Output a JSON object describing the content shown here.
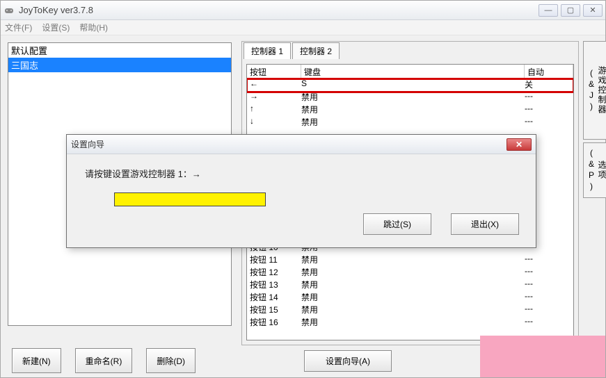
{
  "window": {
    "title": "JoyToKey ver3.7.8"
  },
  "menu": {
    "file": "文件(F)",
    "settings": "设置(S)",
    "help": "帮助(H)"
  },
  "configs": {
    "item0": "默认配置",
    "item1": "三国志"
  },
  "left_buttons": {
    "new": "新建(N)",
    "rename": "重命名(R)",
    "delete": "删除(D)"
  },
  "tabs": {
    "tab1": "控制器 1",
    "tab2": "控制器 2"
  },
  "table": {
    "headers": {
      "btn": "按钮",
      "kb": "键盘",
      "auto": "自动"
    },
    "rows": [
      {
        "b": "←",
        "k": "S",
        "a": "关"
      },
      {
        "b": "→",
        "k": "禁用",
        "a": "---"
      },
      {
        "b": "↑",
        "k": "禁用",
        "a": "---"
      },
      {
        "b": "↓",
        "k": "禁用",
        "a": "---"
      },
      {
        "b": "按钮 10",
        "k": "禁用",
        "a": "---"
      },
      {
        "b": "按钮 11",
        "k": "禁用",
        "a": "---"
      },
      {
        "b": "按钮 12",
        "k": "禁用",
        "a": "---"
      },
      {
        "b": "按钮 13",
        "k": "禁用",
        "a": "---"
      },
      {
        "b": "按钮 14",
        "k": "禁用",
        "a": "---"
      },
      {
        "b": "按钮 15",
        "k": "禁用",
        "a": "---"
      },
      {
        "b": "按钮 16",
        "k": "禁用",
        "a": "---"
      }
    ]
  },
  "sidebar": {
    "gamectrl": "游戏控制器(&J)",
    "options": "选项(&P)"
  },
  "bottom": {
    "wizard": "设置向导(A)"
  },
  "dialog": {
    "title": "设置向导",
    "message": "请按键设置游戏控制器 1：→",
    "skip": "跳过(S)",
    "exit": "退出(X)"
  }
}
